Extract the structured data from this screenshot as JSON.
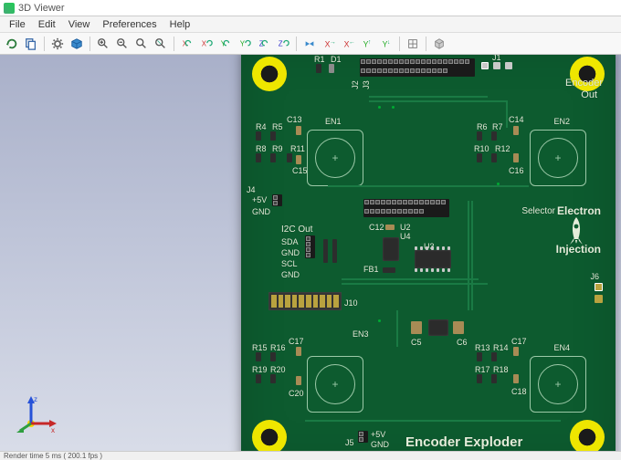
{
  "window": {
    "title": "3D Viewer"
  },
  "menu": {
    "file": "File",
    "edit": "Edit",
    "view": "View",
    "preferences": "Preferences",
    "help": "Help"
  },
  "status": {
    "text": "Render time 5 ms ( 200.1 fps )"
  },
  "pcb": {
    "title": "Encoder Exploder",
    "brand1": "Selector",
    "brand2": "Electron",
    "brand3": "Injection",
    "encoder_out": "Encoder",
    "encoder_out2": "Out",
    "i2c_out": "I2C Out",
    "plus5v": "+5V",
    "gnd": "GND",
    "sda": "SDA",
    "scl": "SCL",
    "refs": {
      "r1": "R1",
      "d1": "D1",
      "j1": "J1",
      "j2": "J2",
      "j3": "J3",
      "j4": "J4",
      "j5": "J5",
      "j6": "J6",
      "j10": "J10",
      "en1": "EN1",
      "en2": "EN2",
      "en3": "EN3",
      "en4": "EN4",
      "r4": "R4",
      "r5": "R5",
      "r6": "R6",
      "r7": "R7",
      "r8": "R8",
      "r9": "R9",
      "r10": "R10",
      "r11": "R11",
      "r12": "R12",
      "r13": "R13",
      "r14": "R14",
      "r15": "R15",
      "r16": "R16",
      "r17": "R17",
      "r18": "R18",
      "r19": "R19",
      "r20": "R20",
      "c5": "C5",
      "c6": "C6",
      "c12": "C12",
      "c13": "C13",
      "c14": "C14",
      "c15": "C15",
      "c16": "C16",
      "c17": "C17",
      "c18": "C18",
      "c20": "C20",
      "u2": "U2",
      "u3": "U3",
      "u4": "U4",
      "fb1": "FB1"
    }
  }
}
